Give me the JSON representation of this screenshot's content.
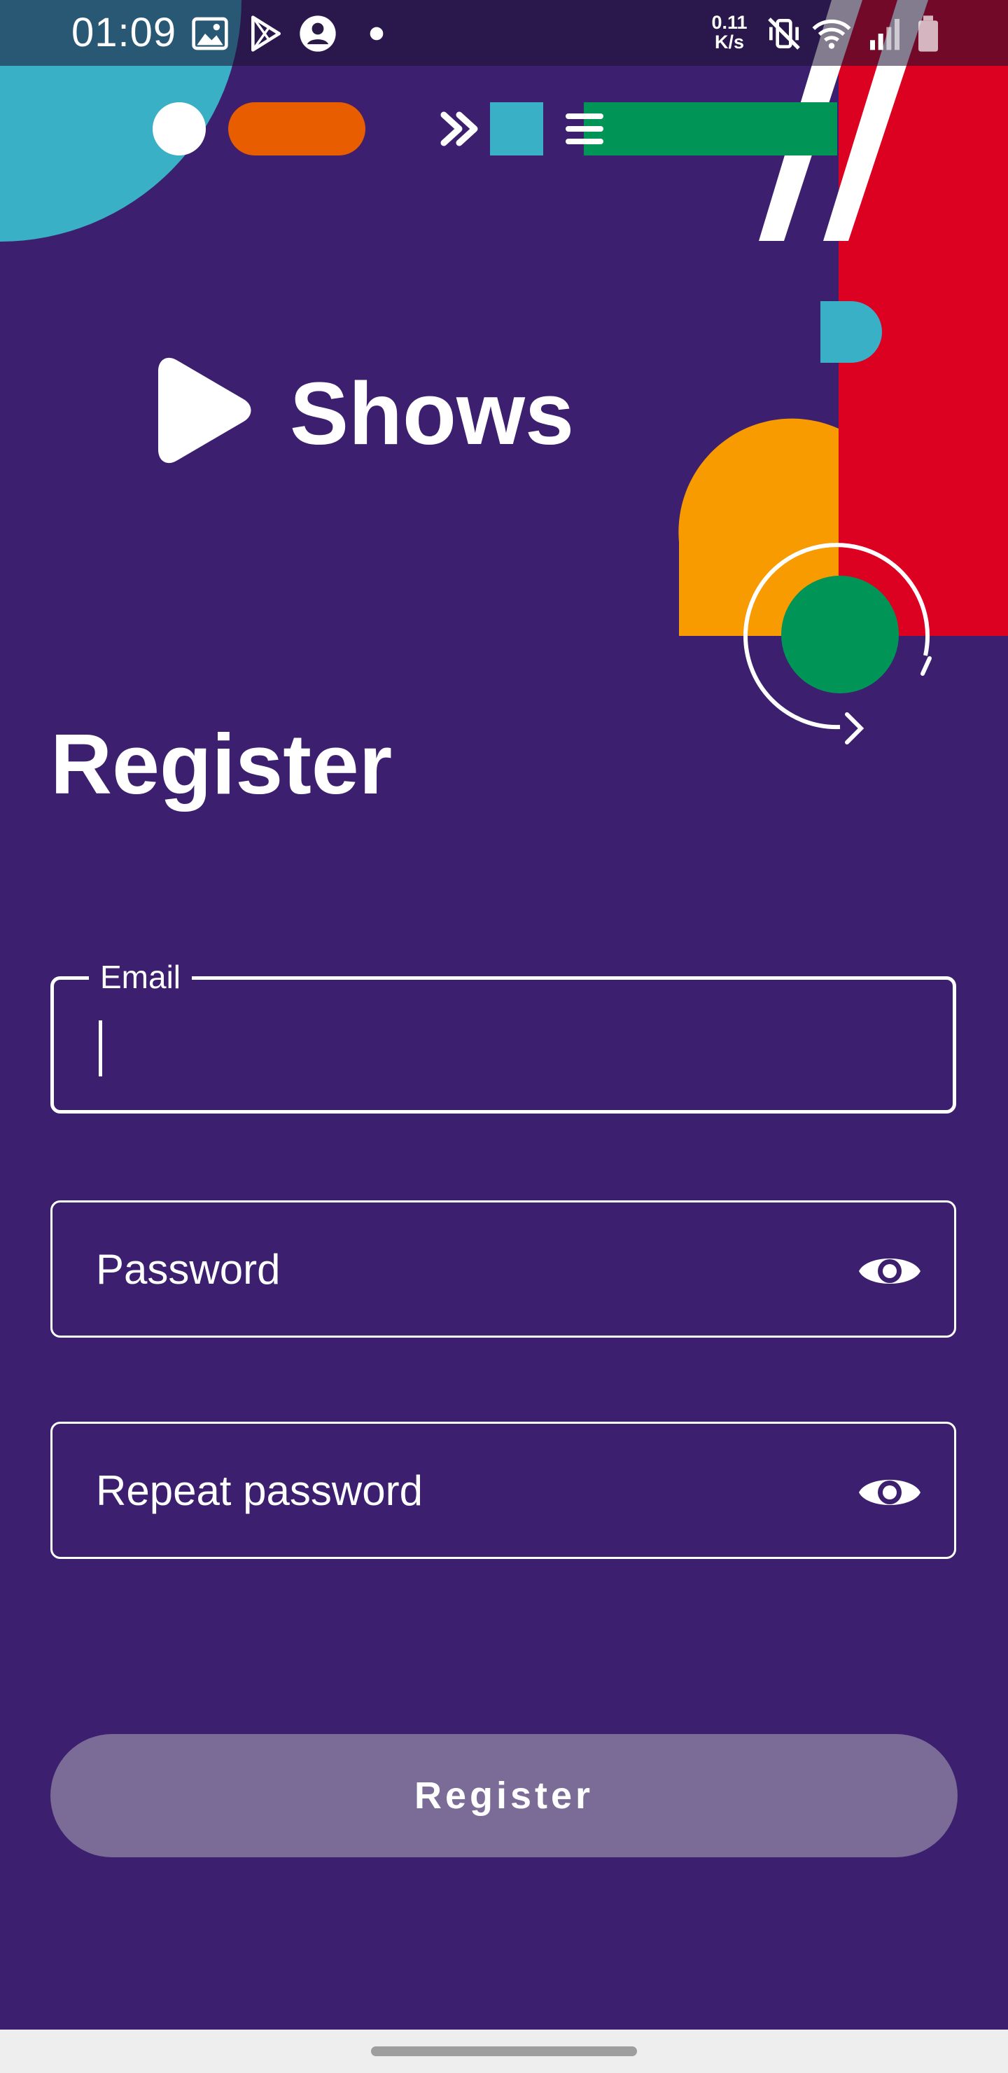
{
  "status_bar": {
    "time": "01:09",
    "net_speed_value": "0.11",
    "net_speed_unit": "K/s",
    "icons": [
      "gallery-icon",
      "play-store-icon",
      "account-circle-icon",
      "dot-icon",
      "vibrate-mute-icon",
      "wifi-icon",
      "signal-icon",
      "battery-icon"
    ]
  },
  "brand": {
    "name": "Shows",
    "logo_icon": "play-triangle-icon"
  },
  "page": {
    "title": "Register"
  },
  "form": {
    "email": {
      "label": "Email",
      "value": ""
    },
    "password": {
      "placeholder": "Password",
      "value": "",
      "toggle_icon": "eye-icon"
    },
    "repeat_password": {
      "placeholder": "Repeat password",
      "value": "",
      "toggle_icon": "eye-icon"
    },
    "submit_label": "Register",
    "submit_enabled": false
  },
  "colors": {
    "background": "#3c1f6e",
    "teal": "#3ab0c6",
    "orange": "#e85d00",
    "green": "#009556",
    "red": "#dc0021",
    "yellow": "#f89b00",
    "button_disabled": "#7b6b97"
  }
}
